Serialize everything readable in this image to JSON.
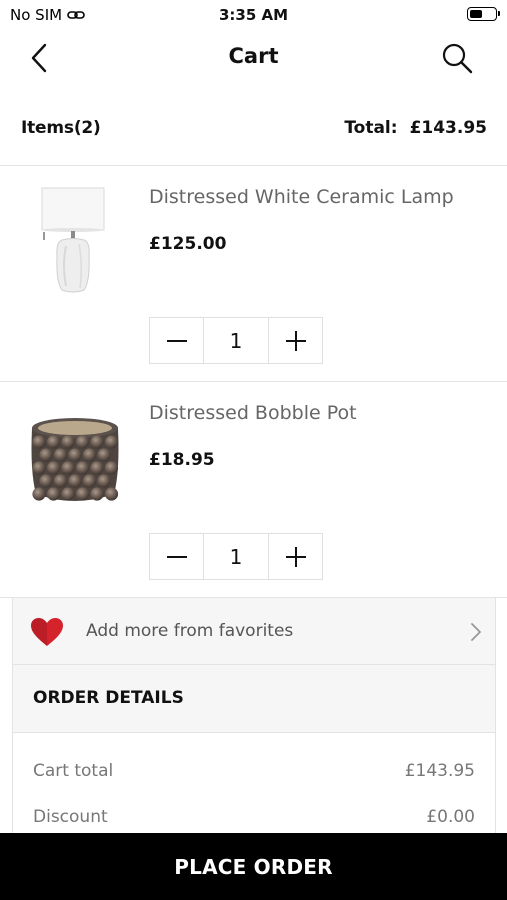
{
  "status_bar": {
    "carrier": "No SIM",
    "time": "3:35 AM",
    "battery_level": 0.5
  },
  "nav": {
    "title": "Cart",
    "back_icon": "chevron-left-icon",
    "search_icon": "search-icon"
  },
  "summary": {
    "items_label": "Items",
    "items_count": "(2)",
    "total_label": "Total:",
    "total_value": "£143.95"
  },
  "products": [
    {
      "name": "Distressed White Ceramic Lamp",
      "price": "£125.00",
      "quantity": "1",
      "image_icon": "lamp-image"
    },
    {
      "name": "Distressed Bobble Pot",
      "price": "£18.95",
      "quantity": "1",
      "image_icon": "bobble-pot-image"
    }
  ],
  "favorites": {
    "label": "Add more from favorites",
    "icon": "heart-icon",
    "heart_color": "#d5232c"
  },
  "order_details": {
    "title": "ORDER DETAILS",
    "lines": [
      {
        "label": "Cart total",
        "value": "£143.95"
      },
      {
        "label": "Discount",
        "value": "£0.00"
      }
    ]
  },
  "place_order": {
    "label": "PLACE ORDER",
    "background": "#000000"
  }
}
